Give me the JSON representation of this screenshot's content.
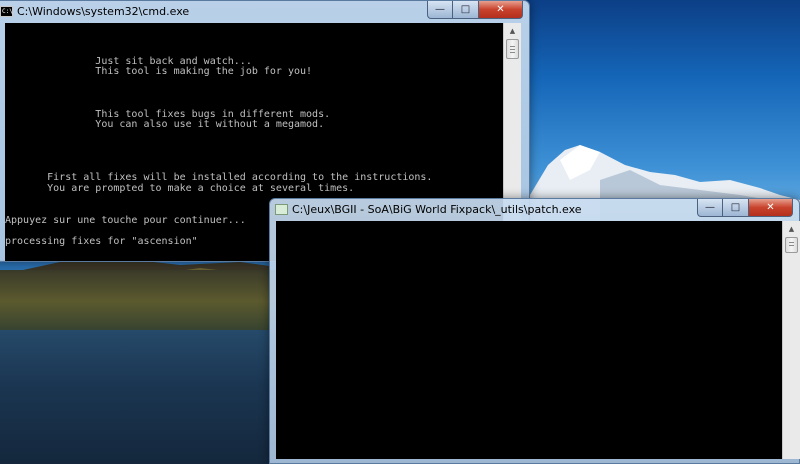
{
  "cmd_window": {
    "title": "C:\\Windows\\system32\\cmd.exe",
    "icon_text": "C:\\",
    "lines": [
      "",
      "",
      "",
      "               Just sit back and watch...",
      "               This tool is making the job for you!",
      "",
      "",
      "",
      "               This tool fixes bugs in different mods.",
      "               You can also use it without a megamod.",
      "",
      "",
      "",
      "",
      "       First all fixes will be installed according to the instructions.",
      "       You are prompted to make a choice at several times.",
      "",
      "",
      "Appuyez sur une touche pour continuer...",
      "",
      "processing fixes for \"ascension\""
    ]
  },
  "patch_window": {
    "title": "C:\\Jeux\\BGII - SoA\\BiG World Fixpack\\_utils\\patch.exe"
  },
  "caption": {
    "minimize": "—",
    "maximize": "□",
    "close": "✕"
  }
}
